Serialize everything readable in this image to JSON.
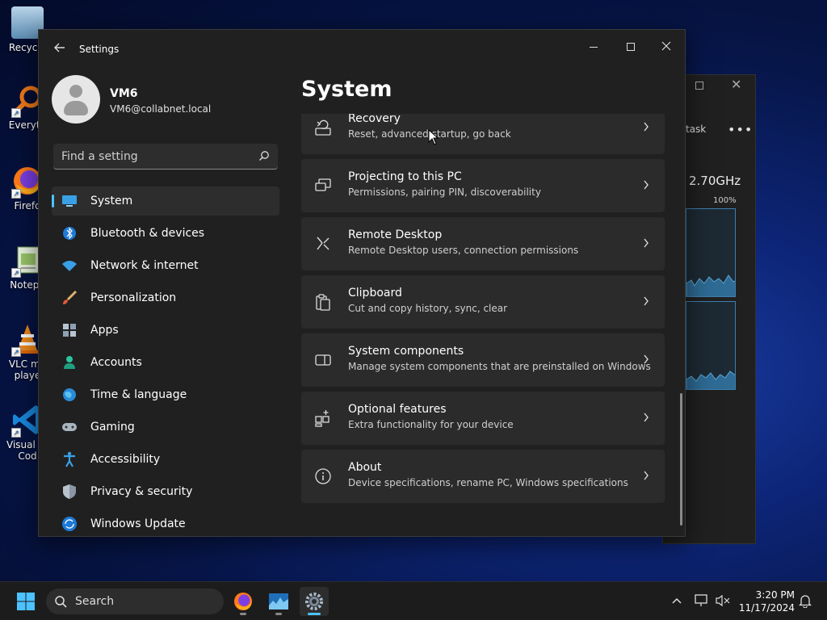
{
  "desktop": {
    "icons": [
      {
        "label": "Recycle"
      },
      {
        "label": "Everyth"
      },
      {
        "label": "Firefo"
      },
      {
        "label": "Notepa"
      },
      {
        "label": "VLC me",
        "label2": "playe"
      },
      {
        "label": "Visual St",
        "label2": "Cod"
      }
    ]
  },
  "background_window": {
    "toolbar_label": "task",
    "more": "•••",
    "cpu_speed": "2.70GHz",
    "percent": "100%"
  },
  "settings": {
    "title": "Settings",
    "user": {
      "name": "VM6",
      "email": "VM6@collabnet.local"
    },
    "search": {
      "placeholder": "Find a setting"
    },
    "nav": [
      {
        "label": "System",
        "icon": "system-icon",
        "active": true
      },
      {
        "label": "Bluetooth & devices",
        "icon": "bluetooth-icon"
      },
      {
        "label": "Network & internet",
        "icon": "network-icon"
      },
      {
        "label": "Personalization",
        "icon": "personalization-icon"
      },
      {
        "label": "Apps",
        "icon": "apps-icon"
      },
      {
        "label": "Accounts",
        "icon": "accounts-icon"
      },
      {
        "label": "Time & language",
        "icon": "time-language-icon"
      },
      {
        "label": "Gaming",
        "icon": "gaming-icon"
      },
      {
        "label": "Accessibility",
        "icon": "accessibility-icon"
      },
      {
        "label": "Privacy & security",
        "icon": "privacy-icon"
      },
      {
        "label": "Windows Update",
        "icon": "windows-update-icon"
      }
    ],
    "page_title": "System",
    "cards": [
      {
        "title": "Recovery",
        "desc": "Reset, advanced startup, go back",
        "icon": "recovery-icon"
      },
      {
        "title": "Projecting to this PC",
        "desc": "Permissions, pairing PIN, discoverability",
        "icon": "projecting-icon"
      },
      {
        "title": "Remote Desktop",
        "desc": "Remote Desktop users, connection permissions",
        "icon": "remote-desktop-icon"
      },
      {
        "title": "Clipboard",
        "desc": "Cut and copy history, sync, clear",
        "icon": "clipboard-icon"
      },
      {
        "title": "System components",
        "desc": "Manage system components that are preinstalled on Windows",
        "icon": "system-components-icon"
      },
      {
        "title": "Optional features",
        "desc": "Extra functionality for your device",
        "icon": "optional-features-icon"
      },
      {
        "title": "About",
        "desc": "Device specifications, rename PC, Windows specifications",
        "icon": "about-icon"
      }
    ]
  },
  "taskbar": {
    "search_label": "Search",
    "apps": [
      {
        "name": "firefox",
        "icon": "firefox-icon"
      },
      {
        "name": "task-manager",
        "icon": "task-manager-icon"
      },
      {
        "name": "settings",
        "icon": "settings-gear-icon",
        "active": true
      }
    ],
    "clock": {
      "time": "3:20 PM",
      "date": "11/17/2024"
    }
  },
  "colors": {
    "accent": "#4cc2ff",
    "window_bg": "#202020",
    "card_bg": "#2b2b2b"
  }
}
